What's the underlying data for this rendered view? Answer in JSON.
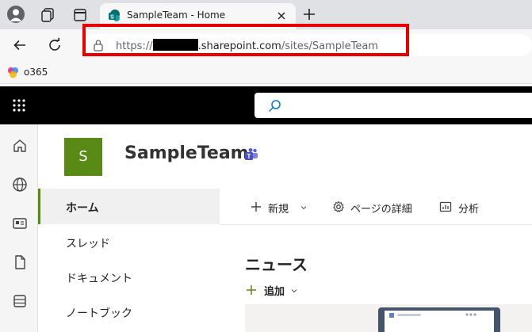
{
  "browser": {
    "tab_title": "SampleTeam - Home",
    "url_prefix": "https://",
    "url_host": ".sharepoint.com",
    "url_path": "/sites/SampleTeam",
    "bookmark_label": "o365"
  },
  "site": {
    "logo_letter": "S",
    "title": "SampleTeam",
    "accent_color": "#5a8a16"
  },
  "nav": {
    "items": [
      "ホーム",
      "スレッド",
      "ドキュメント",
      "ノートブック"
    ]
  },
  "commands": {
    "new_label": "新規",
    "page_details_label": "ページの詳細",
    "analytics_label": "分析"
  },
  "main": {
    "news_title": "ニュース",
    "add_label": "追加"
  },
  "icons": [
    "profile-icon",
    "workspaces-icon",
    "tab-actions-icon",
    "sharepoint-icon",
    "close-icon",
    "plus-icon",
    "back-icon",
    "reload-icon",
    "lock-icon",
    "copilot-icon",
    "waffle-icon",
    "search-icon",
    "home-icon",
    "globe-icon",
    "news-icon",
    "file-icon",
    "list-icon",
    "teams-icon",
    "gear-icon",
    "chart-icon",
    "chevron-down-icon"
  ]
}
